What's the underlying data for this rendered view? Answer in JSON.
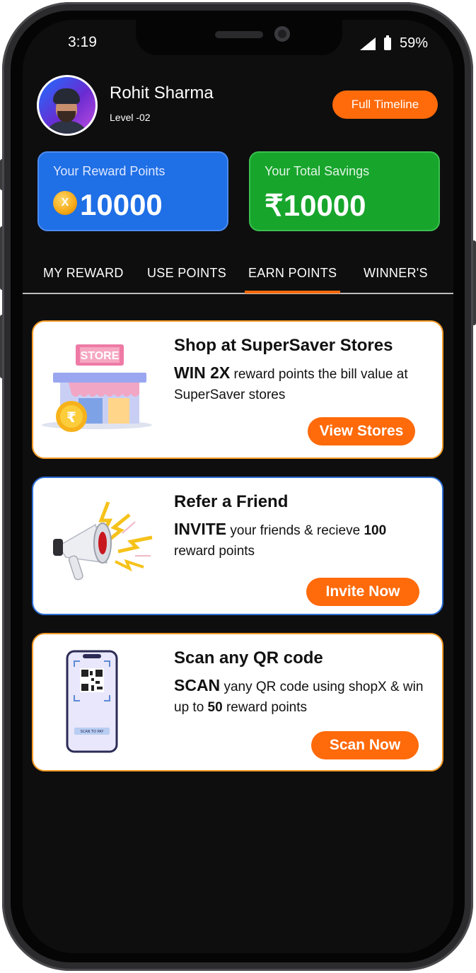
{
  "status": {
    "time": "3:19",
    "battery": "59%"
  },
  "user": {
    "name": "Rohit Sharma",
    "level": "Level -02"
  },
  "timeline_button": "Full Timeline",
  "reward_card": {
    "label": "Your Reward Points",
    "value": "10000",
    "coin_glyph": "X"
  },
  "savings_card": {
    "label": "Your Total Savings",
    "value": "₹10000"
  },
  "tabs": [
    {
      "label": "MY REWARD"
    },
    {
      "label": "USE POINTS"
    },
    {
      "label": "EARN POINTS",
      "active": true
    },
    {
      "label": "WINNER'S"
    }
  ],
  "offers": [
    {
      "title": "Shop at SuperSaver Stores",
      "highlight": "WIN 2X",
      "text": " reward points the bill value at SuperSaver stores",
      "button": "View Stores",
      "illustration_text": "STORE",
      "coin_glyph": "₹"
    },
    {
      "title": "Refer a Friend",
      "highlight": "INVITE",
      "text_a": " your friends & recieve ",
      "text_bold": "100",
      "text_b": " reward points",
      "button": "Invite Now"
    },
    {
      "title": "Scan any QR code",
      "highlight": "SCAN",
      "text_a": " yany QR code using shopX & win up to ",
      "text_bold": "50",
      "text_b": " reward points",
      "button": "Scan Now",
      "illustration_text": "SCAN TO PAY"
    }
  ],
  "colors": {
    "accent": "#ff6a0a",
    "reward_blue": "#1f6fe6",
    "savings_green": "#17a52c"
  }
}
